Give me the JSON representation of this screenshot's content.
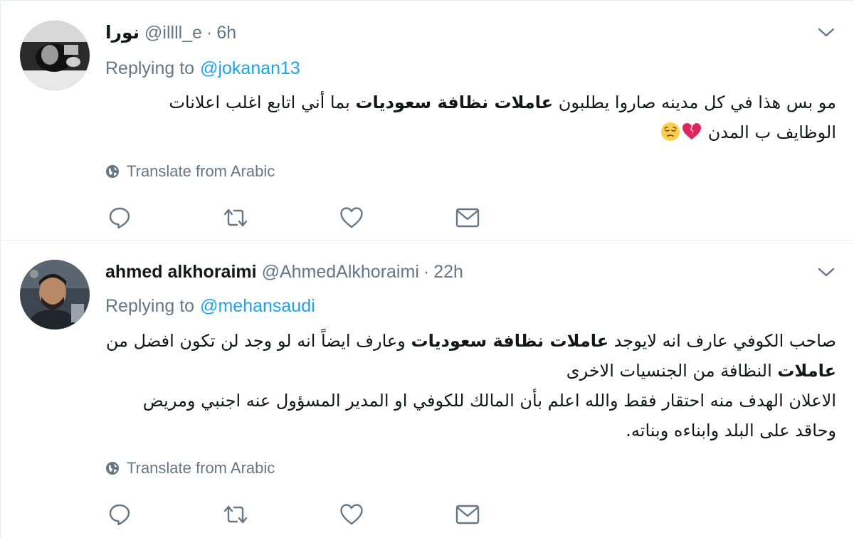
{
  "tweets": [
    {
      "fullname": "نورا",
      "screenname": "@illll_e",
      "separator": "·",
      "time": "6h",
      "reply_label": "Replying to",
      "reply_to": "@jokanan13",
      "text": {
        "p1": "مو بس هذا في كل مدينه صاروا يطلبون ",
        "bold1": "عاملات نظافة سعوديات",
        "p2": " بما أني اتابع اغلب اعلانات الوظايف ب المدن"
      },
      "translate": "Translate from Arabic",
      "emoji": [
        "broken-heart-emoji",
        "pensive-face-emoji"
      ]
    },
    {
      "fullname": "ahmed alkhoraimi",
      "screenname": "@AhmedAlkhoraimi",
      "separator": "·",
      "time": "22h",
      "reply_label": "Replying to",
      "reply_to": "@mehansaudi",
      "text": {
        "p1": "صاحب الكوفي عارف انه لايوجد ",
        "bold1": "عاملات نظافة سعوديات",
        "p2": " وعارف ايضاً انه لو وجد لن تكون افضل من ",
        "bold2": "عاملات",
        "p3": " النظافة من الجنسيات الاخرى",
        "p4": "الاعلان الهدف منه احتقار فقط والله اعلم بأن المالك للكوفي او المدير المسؤول عنه اجنبي ومريض وحاقد على البلد وابناءه وبناته."
      },
      "translate": "Translate from Arabic"
    }
  ],
  "colors": {
    "text": "#14171a",
    "secondary": "#657786",
    "link": "#1da1f2",
    "divider": "#e6ecf0"
  },
  "icons": [
    "chevron-down-icon",
    "globe-icon",
    "reply-icon",
    "retweet-icon",
    "like-icon",
    "direct-message-icon"
  ]
}
